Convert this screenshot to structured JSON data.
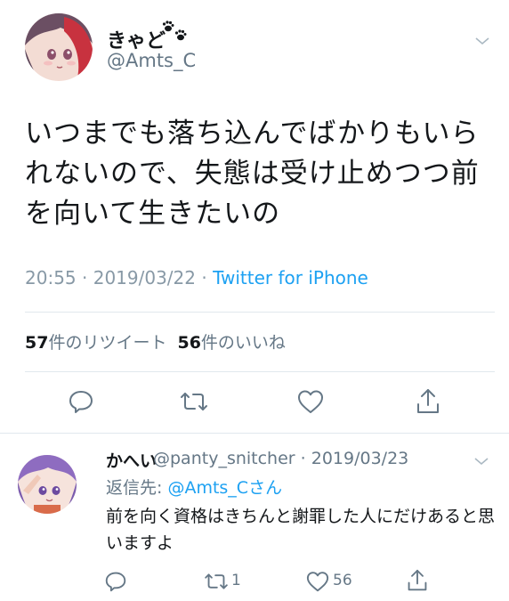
{
  "tweet": {
    "display_name": "きゃど",
    "handle": "@Amts_C",
    "text": "いつまでも落ち込んでばかりもいられないので、失態は受け止めつつ前を向いて生きたいの",
    "time": "20:55",
    "date": "2019/03/22",
    "source": "Twitter for iPhone",
    "retweet_count": "57",
    "retweet_label": "件のリツイート",
    "like_count": "56",
    "like_label": "件のいいね"
  },
  "reply": {
    "display_name": "かへい",
    "handle": "@panty_snitcher",
    "date": "2019/03/23",
    "reply_to_label": "返信先: ",
    "reply_to_mention": "@Amts_C",
    "reply_to_suffix": "さん",
    "text": "前を向く資格はきちんと謝罪した人にだけあると思いますよ",
    "retweet_count": "1",
    "like_count": "56"
  },
  "colors": {
    "accent": "#1da1f2",
    "text": "#14171a",
    "secondary": "#657786",
    "divider": "#e1e8ed"
  },
  "icons": {
    "main_avatar": "anime-avatar-red-hair",
    "reply_avatar": "anime-avatar-purple-hair",
    "name_decoration": "paw-prints-icon",
    "menu": "chevron-down-icon",
    "reply": "reply-icon",
    "retweet": "retweet-icon",
    "like": "heart-icon",
    "share": "share-icon"
  }
}
